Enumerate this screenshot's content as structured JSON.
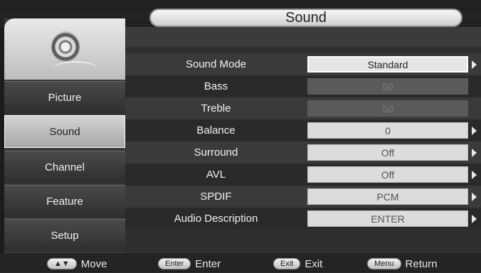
{
  "title": "Sound",
  "sidebar": {
    "logo_icon": "speaker-icon",
    "items": [
      {
        "label": "Picture",
        "active": false
      },
      {
        "label": "Sound",
        "active": true
      },
      {
        "label": "Channel",
        "active": false
      },
      {
        "label": "Feature",
        "active": false
      },
      {
        "label": "Setup",
        "active": false
      }
    ]
  },
  "settings": [
    {
      "label": "Sound Mode",
      "value": "Standard",
      "state": "selected",
      "arrow": true
    },
    {
      "label": "Bass",
      "value": "50",
      "state": "disabled",
      "arrow": false
    },
    {
      "label": "Treble",
      "value": "50",
      "state": "disabled",
      "arrow": false
    },
    {
      "label": "Balance",
      "value": "0",
      "state": "normal",
      "arrow": true
    },
    {
      "label": "Surround",
      "value": "Off",
      "state": "normal",
      "arrow": true
    },
    {
      "label": "AVL",
      "value": "Off",
      "state": "normal",
      "arrow": true
    },
    {
      "label": "SPDIF",
      "value": "PCM",
      "state": "normal",
      "arrow": true
    },
    {
      "label": "Audio Description",
      "value": "ENTER",
      "state": "normal",
      "arrow": true
    }
  ],
  "footer": {
    "move": {
      "key": "▲▼",
      "label": "Move"
    },
    "enter": {
      "key": "Enter",
      "label": "Enter"
    },
    "exit": {
      "key": "Exit",
      "label": "Exit"
    },
    "menu": {
      "key": "Menu",
      "label": "Return"
    }
  }
}
